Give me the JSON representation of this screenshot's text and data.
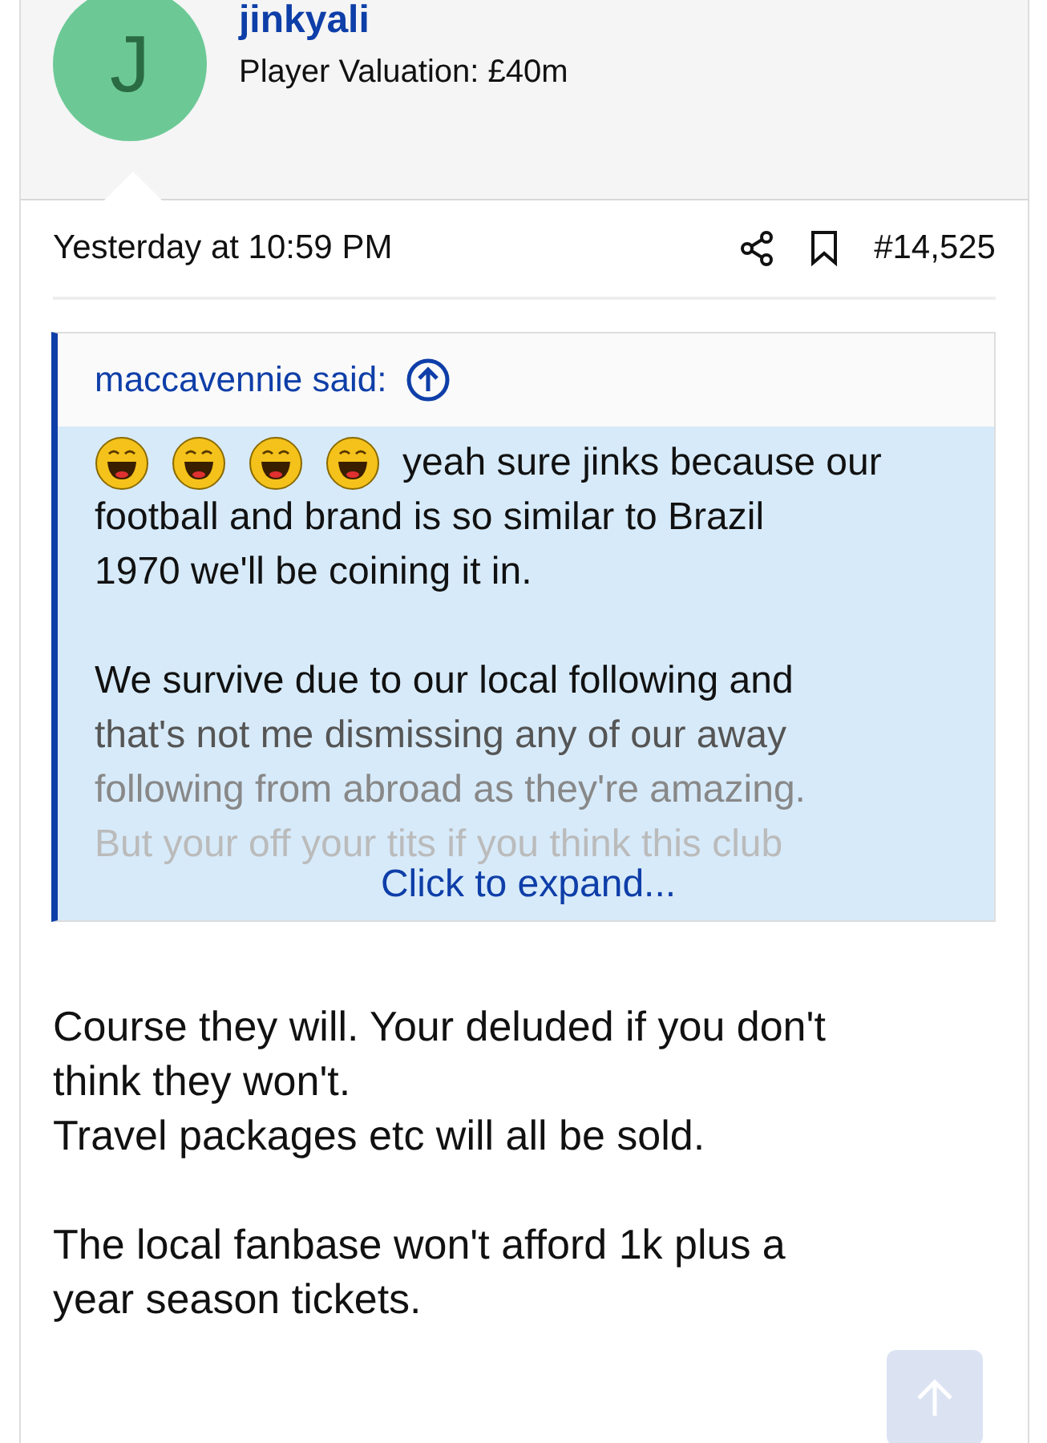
{
  "author": {
    "initial": "J",
    "name": "jinkyali",
    "title": "Player Valuation: £40m"
  },
  "post": {
    "time": "Yesterday at 10:59 PM",
    "number": "#14,525"
  },
  "quote": {
    "attribution": "maccavennie said:",
    "emojis": [
      {
        "kind": "laughing"
      },
      {
        "kind": "laughing"
      },
      {
        "kind": "laughing"
      },
      {
        "kind": "laughing"
      }
    ],
    "paragraphs": [
      [
        "yeah sure jinks because our",
        "football and brand is so similar to Brazil",
        "1970 we'll be coining it in."
      ],
      [
        "We survive due to our local following and",
        "that's not me dismissing any of our away",
        "following from abroad as they're amazing.",
        "But your off your tits if you think this club"
      ]
    ],
    "expand": "Click to expand..."
  },
  "body": [
    [
      "Course they will. Your deluded if you don't",
      "think they won't.",
      "Travel packages etc will all be sold."
    ],
    [
      "The local fanbase won't afford 1k plus a",
      "year season tickets."
    ]
  ]
}
